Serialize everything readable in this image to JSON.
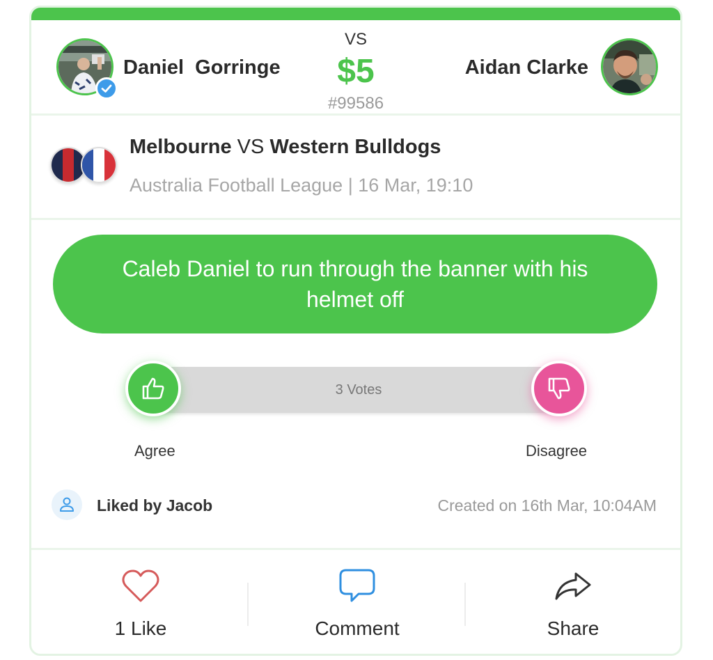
{
  "header": {
    "left_player": {
      "name": "Daniel  Gorringe",
      "verified": true
    },
    "right_player": {
      "name": "Aidan Clarke"
    },
    "vs_label": "VS",
    "amount": "$5",
    "bet_id": "#99586"
  },
  "match": {
    "home_team": "Melbourne",
    "vs_text": " VS ",
    "away_team": "Western Bulldogs",
    "subtitle": "Australia Football League | 16 Mar, 19:10"
  },
  "prediction": {
    "text": "Caleb Daniel to run through the banner with his helmet off"
  },
  "votes": {
    "count_label": "3 Votes",
    "agree_label": "Agree",
    "disagree_label": "Disagree"
  },
  "meta": {
    "liked_by": "Liked by Jacob",
    "created": "Created on 16th Mar, 10:04AM"
  },
  "actions": {
    "like_label": "1 Like",
    "comment_label": "Comment",
    "share_label": "Share"
  },
  "colors": {
    "accent": "#4cc44c",
    "disagree": "#e8559a",
    "verified": "#3d9be9"
  }
}
